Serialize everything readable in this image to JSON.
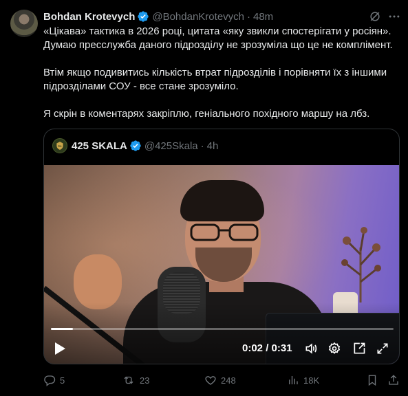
{
  "author": {
    "name": "Bohdan Krotevych",
    "handle": "@BohdanKrotevych",
    "separator": "·",
    "time": "48m"
  },
  "body": {
    "paragraph1_line1": "«Цікава» тактика в 2026 році, цитата «яку звикли спостерігати у росіян».",
    "paragraph1_line2": "Думаю пресслужба даного підрозділу  не зрозуміла що це не комплімент.",
    "paragraph2_line1": "Втім якщо подивитись кількість втрат підрозділів і порівняти їх з іншими",
    "paragraph2_line2": "підрозділами СОУ - все стане зрозуміло.",
    "paragraph3_line1": "Я скрін в коментарях закріплю, геніального похідного маршу на лбз."
  },
  "quote": {
    "name": "425 SKALA",
    "handle": "@425Skala",
    "separator": "·",
    "time": "4h",
    "video": {
      "current_time": "0:02",
      "duration": "0:31",
      "time_separator": " / ",
      "progress_fraction": 0.065
    }
  },
  "actions": {
    "replies": "5",
    "reposts": "23",
    "likes": "248",
    "views": "18K"
  },
  "colors": {
    "verified": "#1d9bf0",
    "muted": "#71767b",
    "text": "#e7e9ea"
  },
  "icons": [
    "verified-badge-icon",
    "grok-icon",
    "more-icon",
    "play-icon",
    "volume-icon",
    "settings-icon",
    "pip-icon",
    "fullscreen-icon",
    "reply-icon",
    "repost-icon",
    "like-icon",
    "views-icon",
    "bookmark-icon",
    "share-icon"
  ]
}
